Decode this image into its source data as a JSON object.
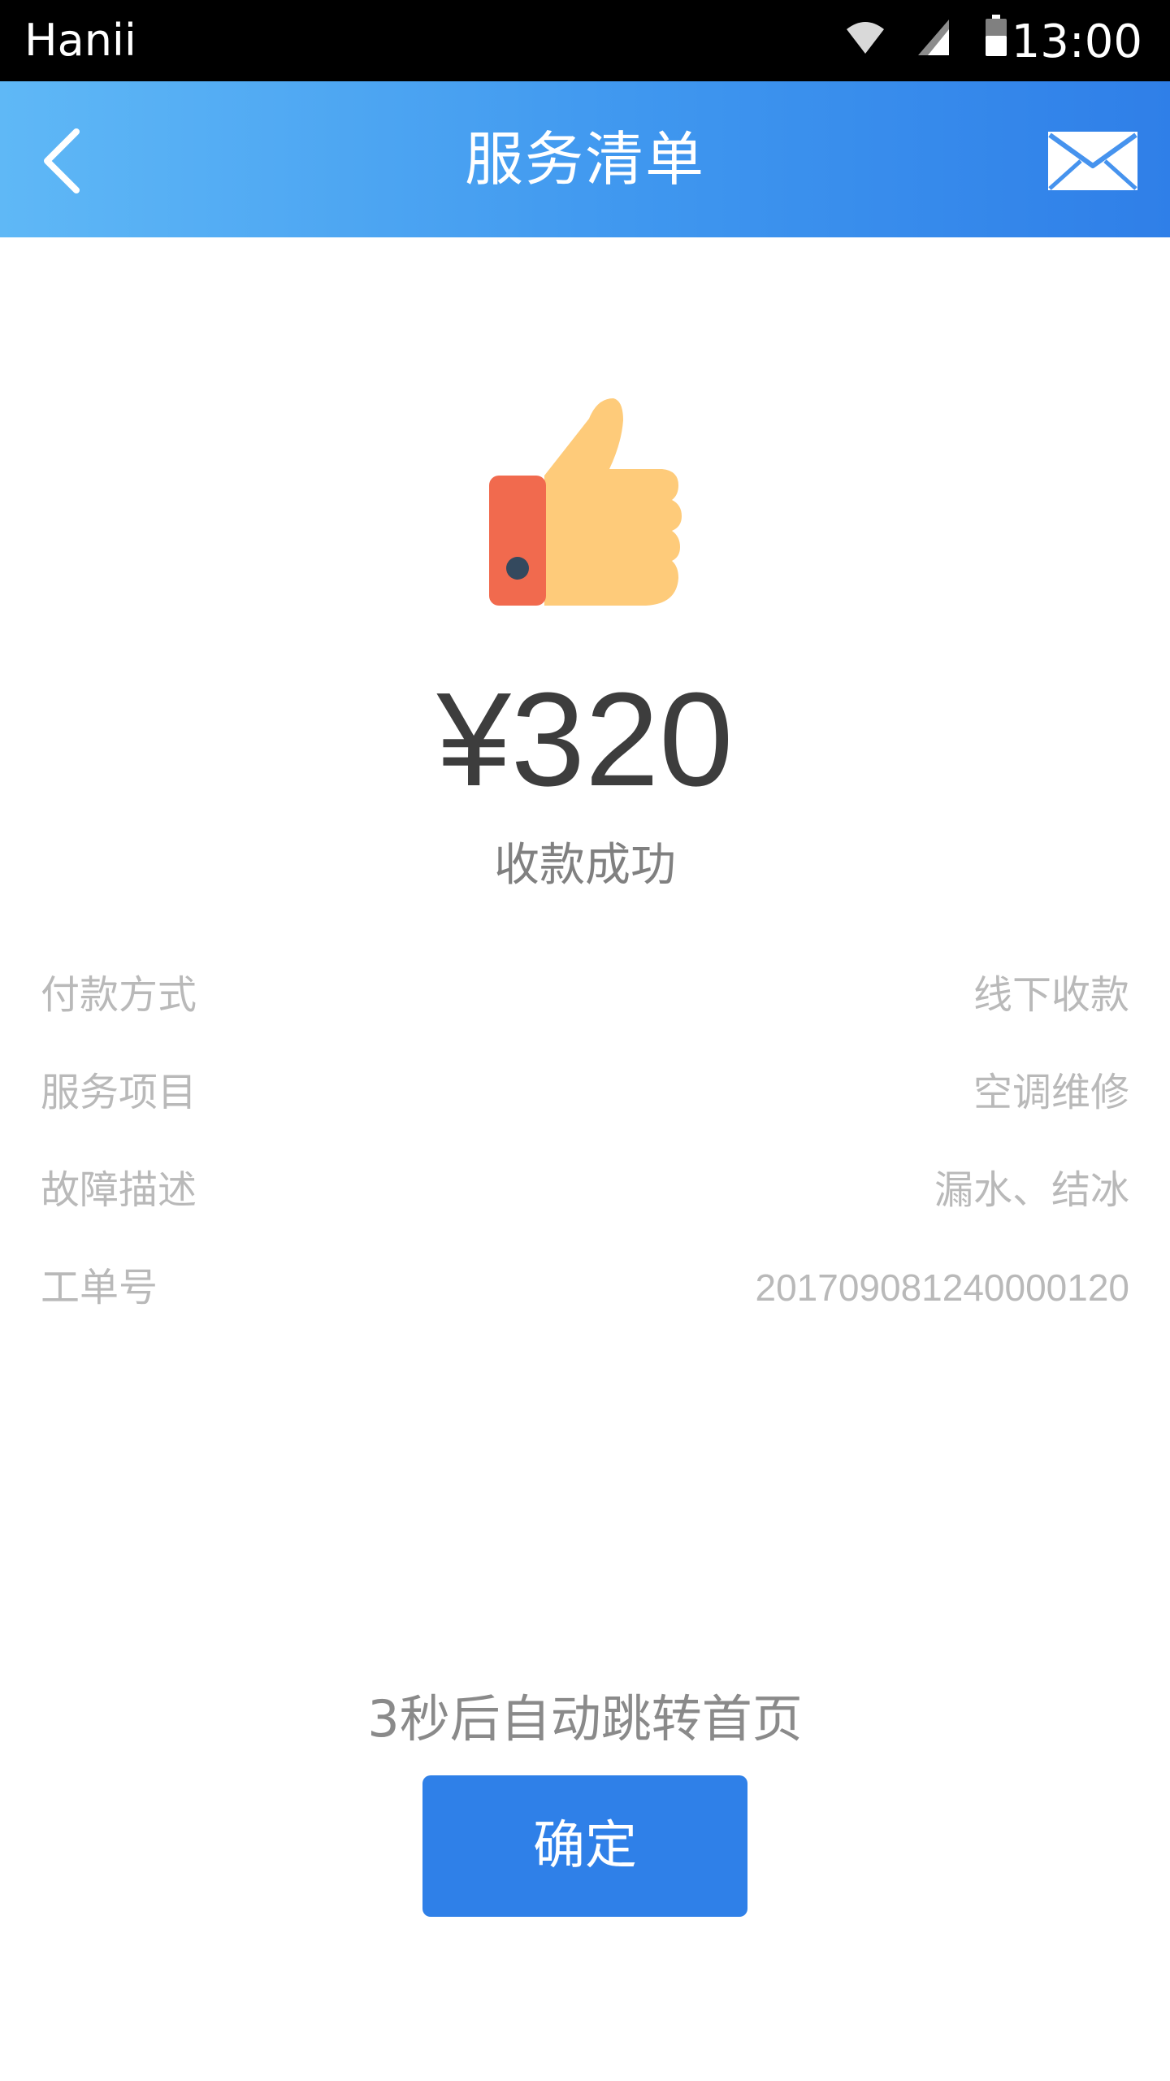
{
  "status_bar": {
    "carrier": "Hanii",
    "time": "13:00",
    "icons": [
      "wifi-icon",
      "signal-icon",
      "battery-icon"
    ]
  },
  "nav": {
    "title": "服务清单",
    "back_icon": "chevron-left-icon",
    "mail_icon": "mail-icon",
    "gradient": [
      "#5fb8f6",
      "#2f7fe8"
    ]
  },
  "result": {
    "icon": "thumbs-up-icon",
    "amount": "¥320",
    "status": "收款成功"
  },
  "details": [
    {
      "label": "付款方式",
      "value": "线下收款"
    },
    {
      "label": "服务项目",
      "value": "空调维修"
    },
    {
      "label": "故障描述",
      "value": "漏水、结冰"
    },
    {
      "label": "工单号",
      "value": "201709081240000120"
    }
  ],
  "footer": {
    "countdown": "3秒后自动跳转首页",
    "confirm_label": "确定"
  },
  "colors": {
    "accent": "#2f80e8",
    "amount_text": "#3d3d3d",
    "detail_text": "#b9b9b9"
  }
}
